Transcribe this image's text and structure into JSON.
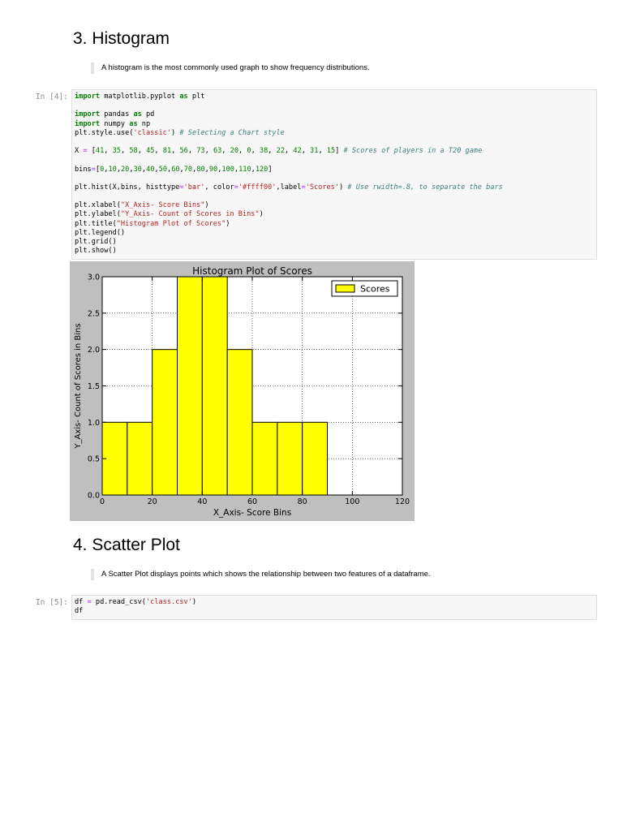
{
  "section3": {
    "heading": "3. Histogram",
    "quote": "A histogram is the most commonly used graph to show frequency distributions.",
    "prompt": "In [4]:",
    "code_lines": [
      "import matplotlib.pyplot as plt",
      "",
      "import pandas as pd",
      "import numpy as np",
      "plt.style.use('classic') # Selecting a Chart style",
      "",
      "X = [41, 35, 58, 45, 81, 56, 73, 63, 20, 0, 38, 22, 42, 31, 15] # Scores of players in a T20 game",
      "",
      "bins=[0,10,20,30,40,50,60,70,80,90,100,110,120]",
      "",
      "plt.hist(X,bins, histtype='bar', color='#ffff00',label='Scores') # Use rwidth=.8, to separate the bars",
      "",
      "plt.xlabel(\"X_Axis- Score Bins\")",
      "plt.ylabel(\"Y_Axis- Count of Scores in Bins\")",
      "plt.title(\"Histogram Plot of Scores\")",
      "plt.legend()",
      "plt.grid()",
      "plt.show()"
    ]
  },
  "chart_data": {
    "type": "bar",
    "title": "Histogram Plot of Scores",
    "xlabel": "X_Axis- Score Bins",
    "ylabel": "Y_Axis- Count of Scores in Bins",
    "bins": [
      0,
      10,
      20,
      30,
      40,
      50,
      60,
      70,
      80,
      90,
      100,
      110,
      120
    ],
    "values": [
      1,
      1,
      2,
      3,
      3,
      2,
      1,
      1,
      1,
      0,
      0,
      0
    ],
    "series": [
      {
        "name": "Scores",
        "values": [
          1,
          1,
          2,
          3,
          3,
          2,
          1,
          1,
          1,
          0,
          0,
          0
        ]
      }
    ],
    "xlim": [
      0,
      120
    ],
    "ylim": [
      0,
      3.0
    ],
    "xticks": [
      "0",
      "20",
      "40",
      "60",
      "80",
      "100",
      "120"
    ],
    "xtick_values": [
      0,
      20,
      40,
      60,
      80,
      100,
      120
    ],
    "yticks": [
      "0.0",
      "0.5",
      "1.0",
      "1.5",
      "2.0",
      "2.5",
      "3.0"
    ],
    "ytick_values": [
      0,
      0.5,
      1.0,
      1.5,
      2.0,
      2.5,
      3.0
    ],
    "grid": true,
    "legend": "top-right",
    "bar_color": "#ffff00",
    "figure_background": "#bfbfbf"
  },
  "section4": {
    "heading": "4. Scatter Plot",
    "quote": "A Scatter Plot displays points which shows the relationship between two features of a dataframe.",
    "prompt": "In [5]:",
    "code_lines": [
      "df = pd.read_csv('class.csv')",
      "df"
    ]
  }
}
